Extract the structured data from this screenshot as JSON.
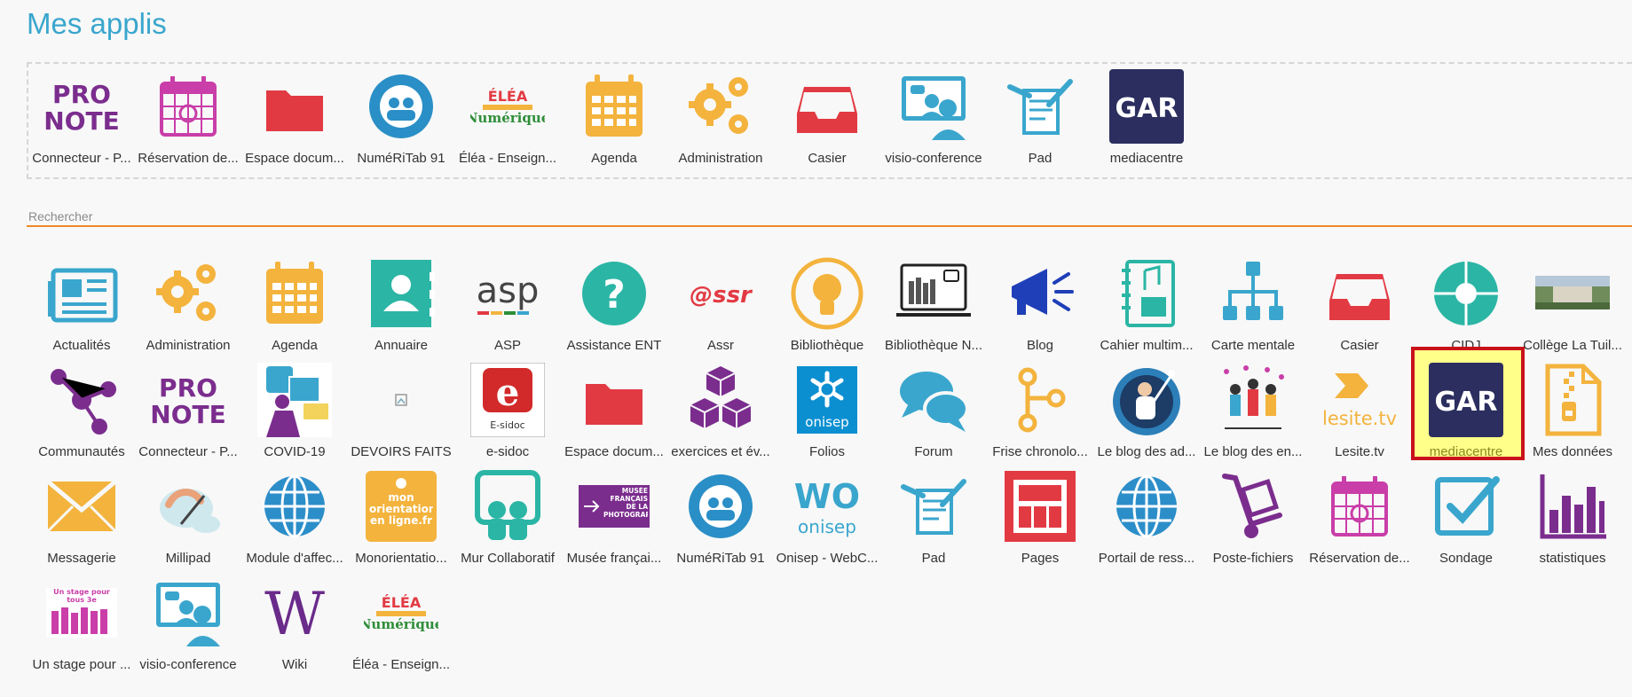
{
  "header": {
    "title": "Mes applis"
  },
  "favorites": [
    {
      "label": "Connecteur - P...",
      "icon": "pronote-icon"
    },
    {
      "label": "Réservation de...",
      "icon": "calendar-booking-icon"
    },
    {
      "label": "Espace docum...",
      "icon": "folder-icon"
    },
    {
      "label": "NuméRiTab 91",
      "icon": "numeritab-icon"
    },
    {
      "label": "Éléa - Enseign...",
      "icon": "elea-icon"
    },
    {
      "label": "Agenda",
      "icon": "agenda-icon"
    },
    {
      "label": "Administration",
      "icon": "gears-icon"
    },
    {
      "label": "Casier",
      "icon": "inbox-tray-icon"
    },
    {
      "label": "visio-conference",
      "icon": "visio-icon"
    },
    {
      "label": "Pad",
      "icon": "pad-icon"
    },
    {
      "label": "mediacentre",
      "icon": "gar-icon"
    }
  ],
  "search": {
    "placeholder": "Rechercher"
  },
  "apps": [
    {
      "label": "Actualités",
      "icon": "newspaper-icon"
    },
    {
      "label": "Administration",
      "icon": "gears-icon"
    },
    {
      "label": "Agenda",
      "icon": "agenda-icon"
    },
    {
      "label": "Annuaire",
      "icon": "contact-book-icon"
    },
    {
      "label": "ASP",
      "icon": "asp-logo-icon",
      "text": "asp"
    },
    {
      "label": "Assistance ENT",
      "icon": "help-icon"
    },
    {
      "label": "Assr",
      "icon": "assr-logo-icon",
      "text": "@ssr"
    },
    {
      "label": "Bibliothèque",
      "icon": "lightbulb-icon"
    },
    {
      "label": "Bibliothèque N...",
      "icon": "digital-library-icon"
    },
    {
      "label": "Blog",
      "icon": "megaphone-icon"
    },
    {
      "label": "Cahier multim...",
      "icon": "multimedia-notebook-icon"
    },
    {
      "label": "Carte mentale",
      "icon": "mindmap-icon"
    },
    {
      "label": "Casier",
      "icon": "inbox-tray-icon"
    },
    {
      "label": "CIDJ",
      "icon": "cidj-icon"
    },
    {
      "label": "Collège La Tuil...",
      "icon": "school-photo-icon"
    },
    {
      "label": "Communautés",
      "icon": "share-icon"
    },
    {
      "label": "Connecteur - P...",
      "icon": "pronote-icon"
    },
    {
      "label": "COVID-19",
      "icon": "covid-icon"
    },
    {
      "label": "DEVOIRS FAITS",
      "icon": "broken-image-icon"
    },
    {
      "label": "e-sidoc",
      "icon": "esidoc-icon",
      "text": "E-sidoc"
    },
    {
      "label": "Espace docum...",
      "icon": "folder-icon"
    },
    {
      "label": "exercices et év...",
      "icon": "cubes-icon"
    },
    {
      "label": "Folios",
      "icon": "onisep-folios-icon",
      "text": "onisep"
    },
    {
      "label": "Forum",
      "icon": "chat-bubbles-icon"
    },
    {
      "label": "Frise chronolo...",
      "icon": "timeline-icon"
    },
    {
      "label": "Le blog des ad...",
      "icon": "blog-illustration-icon"
    },
    {
      "label": "Le blog des en...",
      "icon": "team-illustration-icon"
    },
    {
      "label": "Lesite.tv",
      "icon": "lesitetv-icon",
      "text": "lesite.tv"
    },
    {
      "label": "mediacentre",
      "icon": "gar-icon",
      "selected": true
    },
    {
      "label": "Mes données",
      "icon": "zip-file-icon"
    },
    {
      "label": "Messagerie",
      "icon": "envelope-icon"
    },
    {
      "label": "Millipad",
      "icon": "millipad-icon"
    },
    {
      "label": "Module d'affec...",
      "icon": "globe-icon"
    },
    {
      "label": "Monorientatio...",
      "icon": "monorientation-icon",
      "text": "mon orientation en ligne.fr"
    },
    {
      "label": "Mur Collaboratif",
      "icon": "collab-wall-icon"
    },
    {
      "label": "Musée françai...",
      "icon": "musee-photo-icon",
      "text": "MUSÉE FRANÇAIS DE LA PHOTOGRAPHIE"
    },
    {
      "label": "NuméRiTab 91",
      "icon": "numeritab-icon"
    },
    {
      "label": "Onisep - WebC...",
      "icon": "onisep-wo-icon",
      "text": "onisep"
    },
    {
      "label": "Pad",
      "icon": "pad-icon"
    },
    {
      "label": "Pages",
      "icon": "pages-icon"
    },
    {
      "label": "Portail de ress...",
      "icon": "globe-icon"
    },
    {
      "label": "Poste-fichiers",
      "icon": "hand-truck-icon"
    },
    {
      "label": "Réservation de...",
      "icon": "calendar-booking-icon"
    },
    {
      "label": "Sondage",
      "icon": "checkbox-icon"
    },
    {
      "label": "statistiques",
      "icon": "bar-chart-icon"
    },
    {
      "label": "Un stage pour ...",
      "icon": "stage-icon",
      "text": "Un stage pour tous 3e"
    },
    {
      "label": "visio-conference",
      "icon": "visio-icon"
    },
    {
      "label": "Wiki",
      "icon": "wiki-icon",
      "text": "W"
    },
    {
      "label": "Éléa - Enseign...",
      "icon": "elea-icon"
    }
  ],
  "logo_text": {
    "pronote": [
      "PRO",
      "NOTE"
    ],
    "gar": "GAR",
    "elea": [
      "ÉLÉA",
      "Numérique"
    ]
  },
  "colors": {
    "accent": "#3aa6cd",
    "search_underline": "#f0892a",
    "selected_border": "#c9121b",
    "selected_bg": "#ffff8a"
  }
}
